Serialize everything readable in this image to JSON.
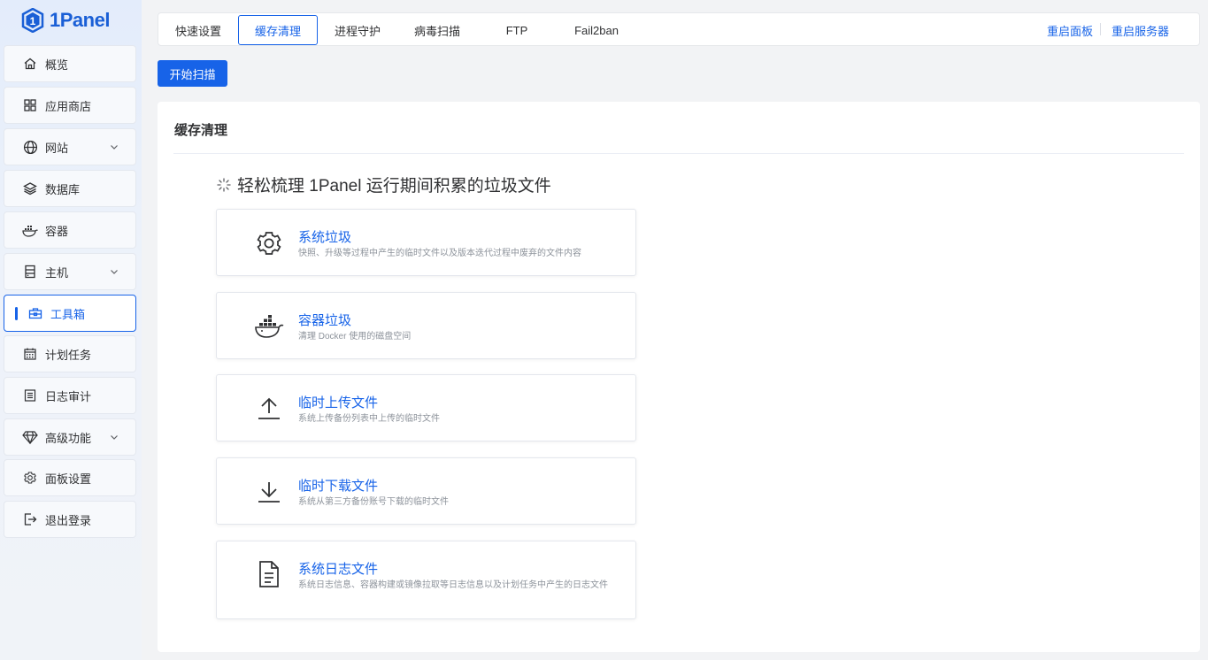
{
  "app": {
    "logo_text": "1Panel"
  },
  "sidebar": {
    "items": [
      {
        "label": "概览",
        "icon": "home-icon"
      },
      {
        "label": "应用商店",
        "icon": "grid-icon"
      },
      {
        "label": "网站",
        "icon": "globe-icon",
        "has_submenu": true
      },
      {
        "label": "数据库",
        "icon": "layers-icon"
      },
      {
        "label": "容器",
        "icon": "docker-icon"
      },
      {
        "label": "主机",
        "icon": "server-icon",
        "has_submenu": true
      },
      {
        "label": "工具箱",
        "icon": "toolbox-icon",
        "active": true
      },
      {
        "label": "计划任务",
        "icon": "calendar-icon"
      },
      {
        "label": "日志审计",
        "icon": "log-icon"
      },
      {
        "label": "高级功能",
        "icon": "diamond-icon",
        "has_submenu": true
      },
      {
        "label": "面板设置",
        "icon": "gear-icon"
      },
      {
        "label": "退出登录",
        "icon": "logout-icon"
      }
    ]
  },
  "tabs": {
    "items": [
      {
        "label": "快速设置"
      },
      {
        "label": "缓存清理",
        "active": true
      },
      {
        "label": "进程守护"
      },
      {
        "label": "病毒扫描"
      },
      {
        "label": "FTP"
      },
      {
        "label": "Fail2ban"
      }
    ],
    "restart_panel": "重启面板",
    "restart_server": "重启服务器"
  },
  "toolbar": {
    "scan_label": "开始扫描"
  },
  "card": {
    "title": "缓存清理",
    "subtitle": "轻松梳理 1Panel 运行期间积累的垃圾文件",
    "items": [
      {
        "title": "系统垃圾",
        "desc": "快照、升级等过程中产生的临时文件以及版本迭代过程中废弃的文件内容",
        "icon": "gear-icon"
      },
      {
        "title": "容器垃圾",
        "desc": "清理 Docker 使用的磁盘空间",
        "icon": "docker-icon"
      },
      {
        "title": "临时上传文件",
        "desc": "系统上传备份列表中上传的临时文件",
        "icon": "upload-icon"
      },
      {
        "title": "临时下载文件",
        "desc": "系统从第三方备份账号下载的临时文件",
        "icon": "download-icon"
      },
      {
        "title": "系统日志文件",
        "desc": "系统日志信息、容器构建或镜像拉取等日志信息以及计划任务中产生的日志文件",
        "icon": "document-icon"
      }
    ]
  },
  "colors": {
    "accent": "#1763e8",
    "desc_text": "#8d939b"
  }
}
